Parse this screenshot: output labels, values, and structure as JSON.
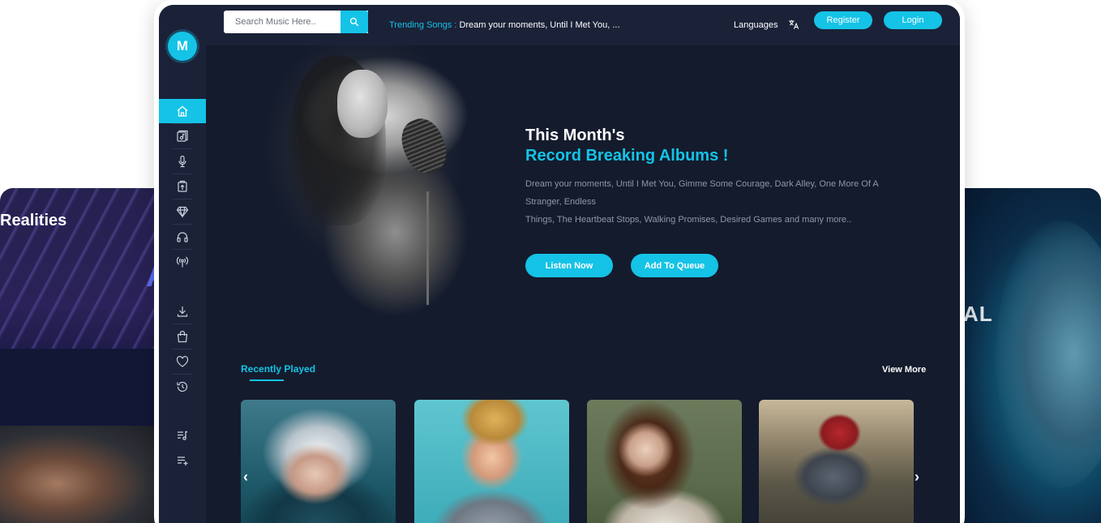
{
  "background_cards": {
    "left_title": "Realities",
    "left_letter": "A",
    "right_word": "AL"
  },
  "app": {
    "logo_letter": "M"
  },
  "sidebar": {
    "items": [
      {
        "icon": "home-icon"
      },
      {
        "icon": "album-icon"
      },
      {
        "icon": "microphone-icon"
      },
      {
        "icon": "genre-icon"
      },
      {
        "icon": "diamond-icon"
      },
      {
        "icon": "headphones-icon"
      },
      {
        "icon": "radio-icon"
      },
      {
        "icon": "download-icon"
      },
      {
        "icon": "shopping-bag-icon"
      },
      {
        "icon": "heart-icon"
      },
      {
        "icon": "history-icon"
      },
      {
        "icon": "playlist-icon"
      },
      {
        "icon": "add-queue-icon"
      }
    ]
  },
  "header": {
    "search_placeholder": "Search Music Here..",
    "trending_label": "Trending Songs :",
    "trending_songs": "Dream your moments, Until I Met You, ...",
    "languages_label": "Languages",
    "register_label": "Register",
    "login_label": "Login"
  },
  "hero": {
    "title_line1": "This Month's",
    "title_line2": "Record Breaking Albums !",
    "description_line1": "Dream your moments, Until I Met You, Gimme Some Courage, Dark Alley, One More Of A Stranger, Endless",
    "description_line2": "Things, The Heartbeat Stops, Walking Promises, Desired Games and many more..",
    "listen_now_label": "Listen Now",
    "add_to_queue_label": "Add To Queue"
  },
  "recently_played": {
    "title": "Recently Played",
    "view_more_label": "View More",
    "prev_arrow": "‹",
    "next_arrow": "›"
  },
  "colors": {
    "accent": "#14c3e6",
    "background": "#141b2d",
    "sidebar": "#1b2238"
  }
}
